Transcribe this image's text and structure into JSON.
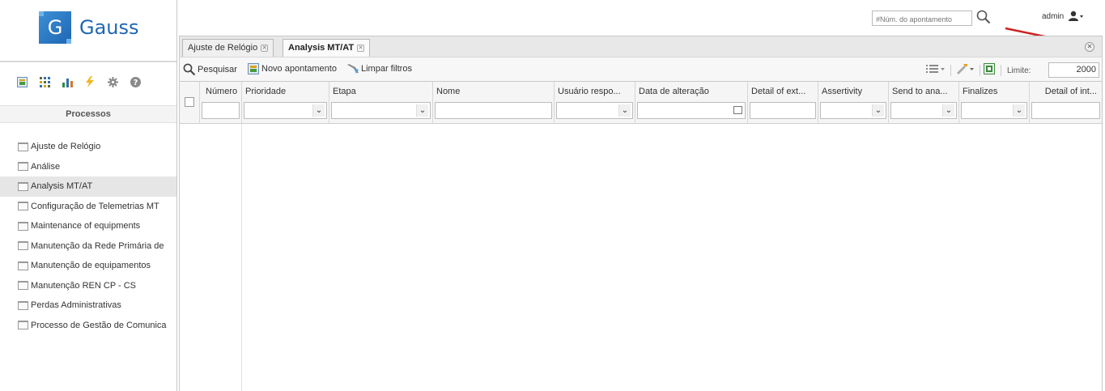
{
  "app": {
    "logo_letter": "G",
    "logo_name": "Gauss"
  },
  "topbar": {
    "search_placeholder": "#Núm. do apontamento",
    "user": "admin"
  },
  "sidebar": {
    "header": "Processos",
    "tools": [
      "dashboard-icon",
      "grid-icon",
      "bar-chart-icon",
      "lightning-icon",
      "gear-icon",
      "help-icon"
    ],
    "items": [
      {
        "label": "Ajuste de Relógio"
      },
      {
        "label": "Análise"
      },
      {
        "label": "Analysis MT/AT",
        "active": true
      },
      {
        "label": "Configuração de Telemetrias MT"
      },
      {
        "label": "Maintenance of equipments"
      },
      {
        "label": "Manutenção da Rede Primária de"
      },
      {
        "label": "Manutenção de equipamentos"
      },
      {
        "label": "Manutenção REN CP - CS"
      },
      {
        "label": "Perdas Administrativas"
      },
      {
        "label": "Processo de Gestão de Comunica"
      }
    ]
  },
  "tabs": [
    {
      "label": "Ajuste de Relógio",
      "active": false
    },
    {
      "label": "Analysis MT/AT",
      "active": true
    }
  ],
  "toolbar": {
    "search": "Pesquisar",
    "new": "Novo apontamento",
    "clear": "Limpar filtros",
    "limit_label": "Limite:",
    "limit_value": "2000"
  },
  "grid": {
    "columns": [
      {
        "label": "Número",
        "filter": "text"
      },
      {
        "label": "Prioridade",
        "filter": "select"
      },
      {
        "label": "Etapa",
        "filter": "select"
      },
      {
        "label": "Nome",
        "filter": "text"
      },
      {
        "label": "Usuário respo...",
        "filter": "select"
      },
      {
        "label": "Data de alteração",
        "filter": "date"
      },
      {
        "label": "Detail of ext...",
        "filter": "text"
      },
      {
        "label": "Assertivity",
        "filter": "select"
      },
      {
        "label": "Send to ana...",
        "filter": "select"
      },
      {
        "label": "Finalizes",
        "filter": "select"
      },
      {
        "label": "Detail of int...",
        "filter": "text"
      }
    ]
  },
  "colors": {
    "brand": "#1f67b3",
    "arrow": "#cc2222"
  }
}
